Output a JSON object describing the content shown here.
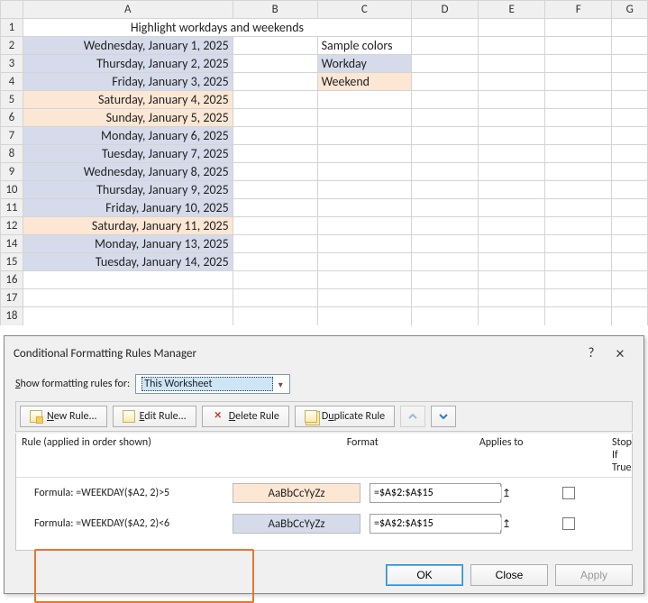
{
  "columns": [
    "A",
    "B",
    "C",
    "D",
    "E",
    "F",
    "G"
  ],
  "rows": [
    "1",
    "2",
    "3",
    "4",
    "5",
    "6",
    "7",
    "8",
    "9",
    "10",
    "11",
    "12",
    "14",
    "15",
    "16",
    "17",
    "18"
  ],
  "title": "Highlight workdays and weekends",
  "sample_label": "Sample colors",
  "sample_workday": "Workday",
  "sample_weekend": "Weekend",
  "dates": [
    {
      "text": "Wednesday, January 1, 2025",
      "fill": "blue"
    },
    {
      "text": "Thursday, January 2, 2025",
      "fill": "blue"
    },
    {
      "text": "Friday, January 3, 2025",
      "fill": "blue"
    },
    {
      "text": "Saturday, January 4, 2025",
      "fill": "orange"
    },
    {
      "text": "Sunday, January 5, 2025",
      "fill": "orange"
    },
    {
      "text": "Monday, January 6, 2025",
      "fill": "blue"
    },
    {
      "text": "Tuesday, January 7, 2025",
      "fill": "blue"
    },
    {
      "text": "Wednesday, January 8, 2025",
      "fill": "blue"
    },
    {
      "text": "Thursday, January 9, 2025",
      "fill": "blue"
    },
    {
      "text": "Friday, January 10, 2025",
      "fill": "blue"
    },
    {
      "text": "Saturday, January 11, 2025",
      "fill": "orange"
    },
    {
      "text": "Monday, January 13, 2025",
      "fill": "blue"
    },
    {
      "text": "Tuesday, January 14, 2025",
      "fill": "blue"
    }
  ],
  "dialog": {
    "title": "Conditional Formatting Rules Manager",
    "show_label_pre": "S",
    "show_label_post": "how formatting rules for:",
    "dropdown": "This Worksheet",
    "new_pre": "N",
    "new_post": "ew Rule...",
    "edit_pre": "E",
    "edit_post": "dit Rule...",
    "del_pre": "D",
    "del_post": "elete Rule",
    "dup_pre": "",
    "dup_mid": "D",
    "dup_mid_u": "u",
    "dup_post": "plicate Rule",
    "header_rule": "Rule (applied in order shown)",
    "header_format": "Format",
    "header_applies": "Applies to",
    "header_stop": "Stop If True",
    "rules": [
      {
        "name": "Formula: =WEEKDAY($A2, 2)>5",
        "preview": "AaBbCcYyZz",
        "applies": "=$A$2:$A$15",
        "fill": "orange"
      },
      {
        "name": "Formula: =WEEKDAY($A2, 2)<6",
        "preview": "AaBbCcYyZz",
        "applies": "=$A$2:$A$15",
        "fill": "blue"
      }
    ],
    "ok": "OK",
    "close": "Close",
    "apply": "Apply"
  }
}
